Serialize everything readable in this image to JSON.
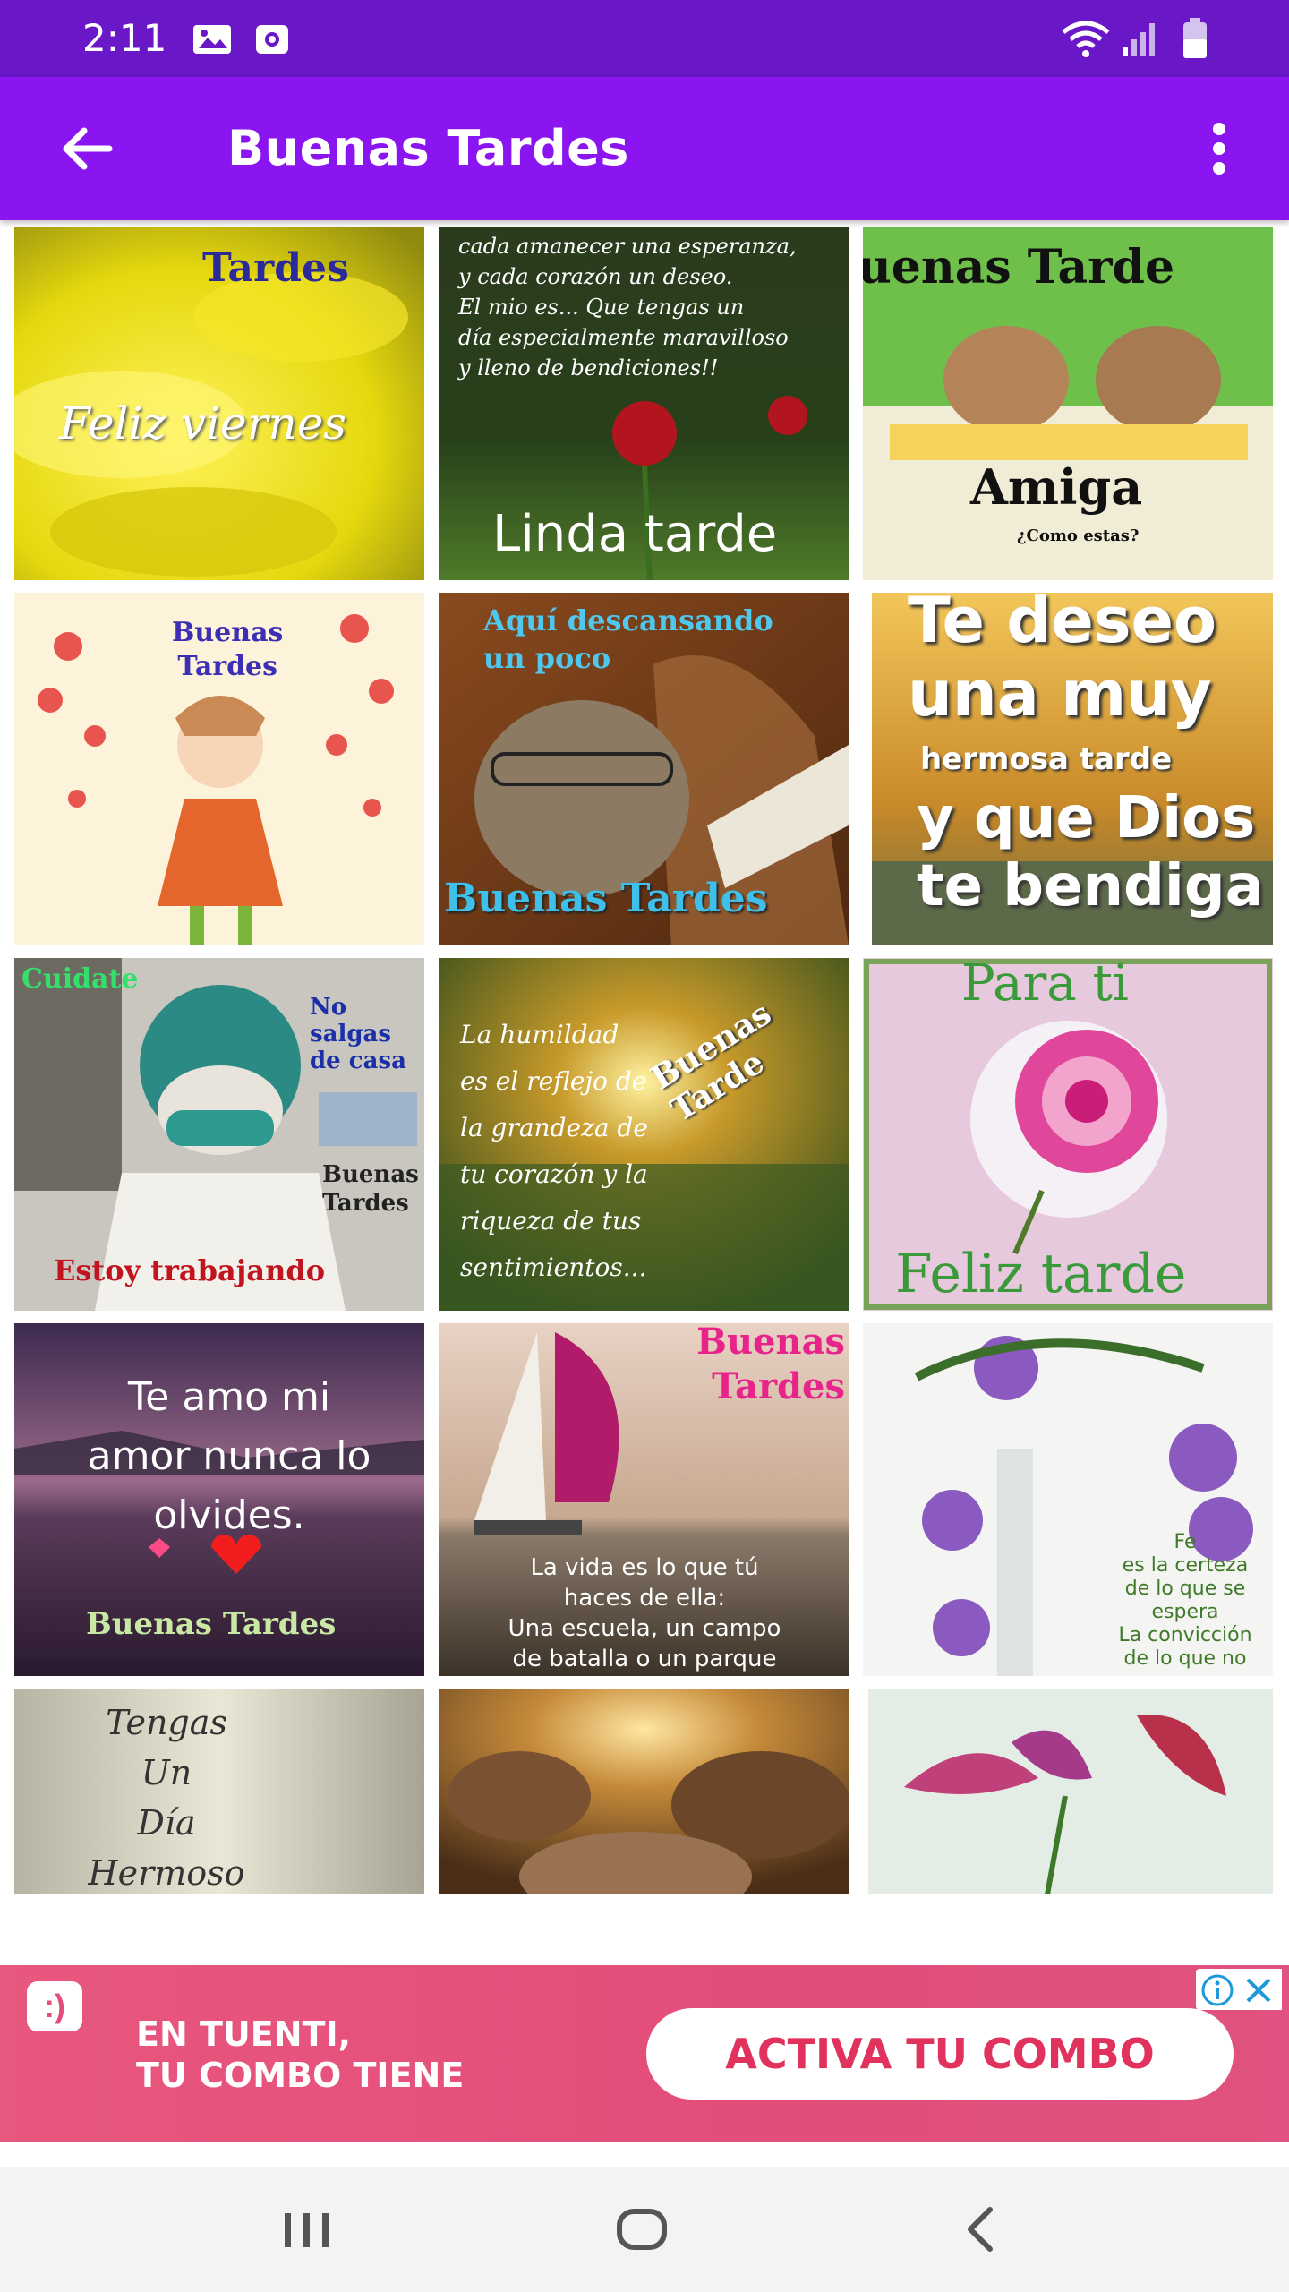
{
  "status_bar": {
    "time": "2:11",
    "icons": [
      "gallery-icon",
      "screen-record-icon",
      "wifi-icon",
      "signal-icon",
      "battery-icon"
    ]
  },
  "app_bar": {
    "title": "Buenas Tardes",
    "back_icon": "arrow-left-icon",
    "menu_icon": "more-vert-icon"
  },
  "tiles": [
    {
      "text": "Tardes\nFeliz viernes"
    },
    {
      "text": "cada amanecer una esperanza,\ny cada corazón un deseo.\nEl mio es... Que tengas un\ndía especialmente maravilloso\ny lleno de bendiciones!!\nLinda tarde"
    },
    {
      "text": "uenas Tarde\nAmiga\n¿Como estas?"
    },
    {
      "text": "Buenas\nTardes"
    },
    {
      "text": "Aquí descansando\nun poco\nBuenas Tardes"
    },
    {
      "text": "Te deseo\nuna muy\nhermosa tarde\ny que Dios\nte bendiga"
    },
    {
      "text": "Cuidate\nNo\nsalgas\nde casa\nBuenas\nTardes\nEstoy trabajando"
    },
    {
      "text": "La humildad\nes el reflejo de\nla grandeza de\ntu corazón y la\nriqueza de tus\nsentimientos...\nBuenas Tarde"
    },
    {
      "text": "Para ti\nFeliz tarde"
    },
    {
      "text": "Te amo mi\namor nunca lo\nolvides.\nBuenas Tardes"
    },
    {
      "text": "Buenas\nTardes\nLa vida es lo que tú\nhaces de ella:\nUna escuela, un campo\nde batalla o un parque"
    },
    {
      "text": "Fe\nes la certeza\nde lo que se\nespera\nLa convicción\nde lo que no"
    },
    {
      "text": "Tengas\nUn\nDía\nHermoso"
    },
    {
      "text": ""
    },
    {
      "text": ""
    }
  ],
  "ad": {
    "logo": ":)",
    "headline": "EN TUENTI,\nTU COMBO TIENE",
    "cta": "ACTIVA TU COMBO",
    "info_icons": [
      "info-icon",
      "close-icon"
    ]
  },
  "nav_bar": {
    "buttons": [
      "recents-icon",
      "home-icon",
      "back-icon"
    ]
  }
}
